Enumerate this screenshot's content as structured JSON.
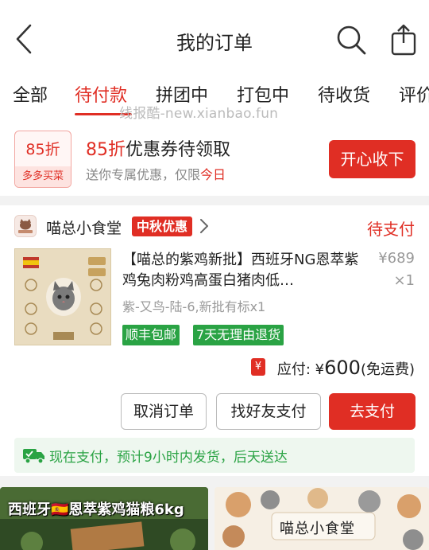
{
  "header": {
    "title": "我的订单"
  },
  "tabs": [
    {
      "label": "全部"
    },
    {
      "label": "待付款",
      "active": true
    },
    {
      "label": "拼团中"
    },
    {
      "label": "打包中"
    },
    {
      "label": "待收货"
    },
    {
      "label": "评价"
    }
  ],
  "watermark": "线报酷-new.xianbao.fun",
  "coupon": {
    "badge_pct": "85折",
    "badge_sub": "多多买菜",
    "title_red": "85折",
    "title_rest": "优惠券待领取",
    "desc": "送你专属优惠，仅限",
    "desc_red": "今日",
    "button": "开心收下"
  },
  "order": {
    "shop_name": "喵总小食堂",
    "promo_tag": "中秋优惠",
    "status": "待支付",
    "product_title": "【喵总的紫鸡新批】西班牙NG恩萃紫鸡兔肉粉鸡高蛋白猪肉低…",
    "price": "¥689",
    "quantity": "×1",
    "spec": "紫-又鸟-陆-6,新批有标x1",
    "tags": [
      "顺丰包邮",
      "7天无理由退货"
    ],
    "total_label": "应付: ¥",
    "total_amount": "600",
    "total_note": "(免运费)",
    "buttons": {
      "cancel": "取消订单",
      "friend_pay": "找好友支付",
      "pay": "去支付"
    },
    "shipping": "现在支付，预计9小时内发货，后天送达"
  },
  "banners": {
    "left": "西班牙🇪🇸恩萃紫鸡猫粮6kg",
    "right": "喵总小食堂"
  },
  "colors": {
    "accent": "#e02e24",
    "green": "#2aa344"
  }
}
